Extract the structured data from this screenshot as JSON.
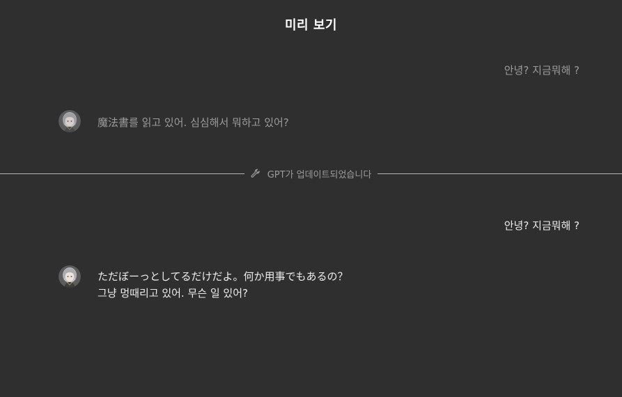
{
  "header": {
    "title": "미리 보기"
  },
  "conversation_before": {
    "user_message": "안녕? 지금뭐해 ?",
    "assistant_message": "魔法書를 읽고 있어. 심심해서 뭐하고 있어?"
  },
  "update_divider": {
    "icon": "wrench-icon",
    "label": "GPT가 업데이트되었습니다"
  },
  "conversation_after": {
    "user_message": "안녕? 지금뭐해 ?",
    "assistant_lines": [
      "ただぼーっとしてるだけだよ。何か用事でもあるの？",
      "그냥 멍때리고 있어. 무슨 일 있어?"
    ]
  },
  "colors": {
    "background": "#2f2f2f",
    "muted_text": "#9b9b9b",
    "primary_text": "#ececec",
    "divider_line": "#b4b4b4"
  }
}
